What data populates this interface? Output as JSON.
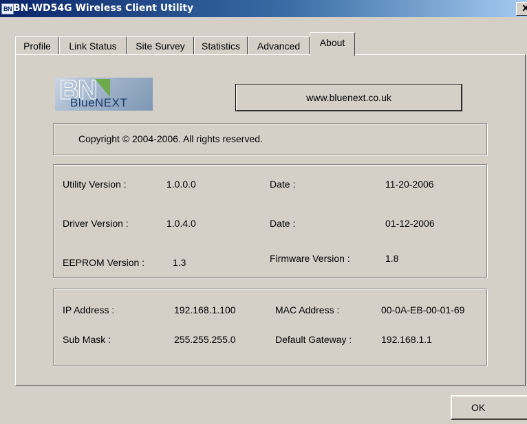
{
  "window": {
    "icon_text": "BN",
    "title": "BN-WD54G Wireless Client Utility",
    "close_glyph": "✕"
  },
  "tabs": [
    {
      "label": "Profile"
    },
    {
      "label": "Link Status"
    },
    {
      "label": "Site Survey"
    },
    {
      "label": "Statistics"
    },
    {
      "label": "Advanced"
    },
    {
      "label": "About"
    }
  ],
  "about": {
    "logo": {
      "monogram": "BN",
      "wordmark": "BlueNEXT",
      "leaf_color": "#6faa4a",
      "text_color": "#163a6b"
    },
    "website_button": "www.bluenext.co.uk",
    "copyright": "Copyright © 2004-2006. All rights reserved.",
    "versions": {
      "utility_label": "Utility Version :",
      "utility_value": "1.0.0.0",
      "utility_date_label": "Date :",
      "utility_date": "11-20-2006",
      "driver_label": "Driver Version :",
      "driver_value": "1.0.4.0",
      "driver_date_label": "Date :",
      "driver_date": "01-12-2006",
      "eeprom_label": "EEPROM Version :",
      "eeprom_value": "1.3",
      "firmware_label": "Firmware Version :",
      "firmware_value": "1.8"
    },
    "network": {
      "ip_label": "IP Address :",
      "ip_value": "192.168.1.100",
      "mac_label": "MAC Address :",
      "mac_value": "00-0A-EB-00-01-69",
      "mask_label": "Sub Mask :",
      "mask_value": "255.255.255.0",
      "gateway_label": "Default Gateway :",
      "gateway_value": "192.168.1.1"
    }
  },
  "ok_button": "OK",
  "colors": {
    "face": "#d4d0c8",
    "title_start": "#0a246a",
    "title_end": "#a6caf0"
  }
}
